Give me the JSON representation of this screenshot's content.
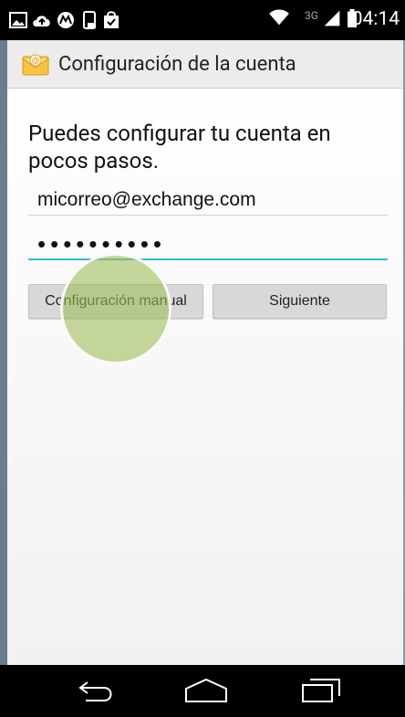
{
  "status_bar": {
    "network_label": "3G",
    "time": "04:14",
    "icons": [
      "image-notification-icon",
      "cloud-upload-icon",
      "motorola-icon",
      "phone-update-icon",
      "shopping-bag-icon",
      "wifi-icon",
      "signal-icon",
      "battery-icon"
    ]
  },
  "action_bar": {
    "title": "Configuración de la cuenta",
    "app_icon": "email-envelope-icon"
  },
  "main": {
    "intro": "Puedes configurar tu cuenta en pocos pasos.",
    "email_value": "micorreo@exchange.com",
    "password_value": "••••••••••",
    "manual_button": "Configuración manual",
    "next_button": "Siguiente"
  },
  "nav_bar": {
    "icons": [
      "back-icon",
      "home-icon",
      "recent-apps-icon"
    ]
  },
  "colors": {
    "accent": "#33b5e5",
    "touch_indicator": "#a0be5a"
  }
}
